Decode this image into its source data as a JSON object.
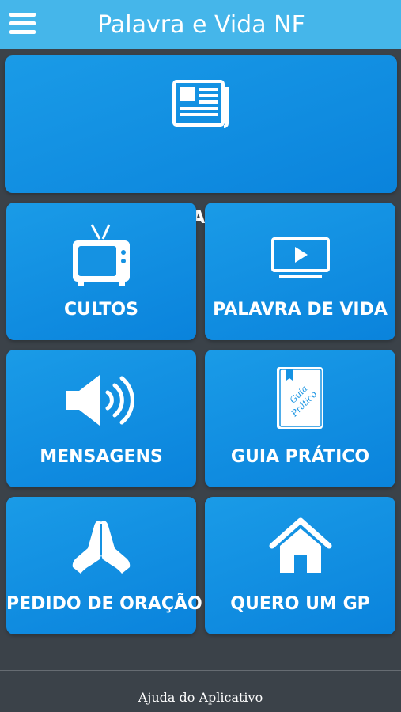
{
  "header": {
    "title": "Palavra e Vida NF",
    "menu_icon": "hamburger-menu-icon"
  },
  "tiles": [
    {
      "label": "LEITURA DIÁRIA",
      "icon": "newspaper-icon"
    },
    {
      "label": "CULTOS",
      "icon": "television-icon"
    },
    {
      "label": "PALAVRA DE VIDA",
      "icon": "video-player-icon"
    },
    {
      "label": "MENSAGENS",
      "icon": "speaker-volume-icon"
    },
    {
      "label": "GUIA PRÁTICO",
      "icon": "guide-book-icon",
      "icon_text": [
        "Guia",
        "Prático"
      ]
    },
    {
      "label": "PEDIDO DE ORAÇÃO",
      "icon": "praying-hands-icon"
    },
    {
      "label": "QUERO UM GP",
      "icon": "house-icon"
    }
  ],
  "footer": {
    "help_link": "Ajuda do Aplicativo"
  },
  "colors": {
    "header_bg": "#45b6ea",
    "tile_bg": "#1a9be7",
    "page_bg": "#3b4249",
    "text": "#ffffff"
  }
}
